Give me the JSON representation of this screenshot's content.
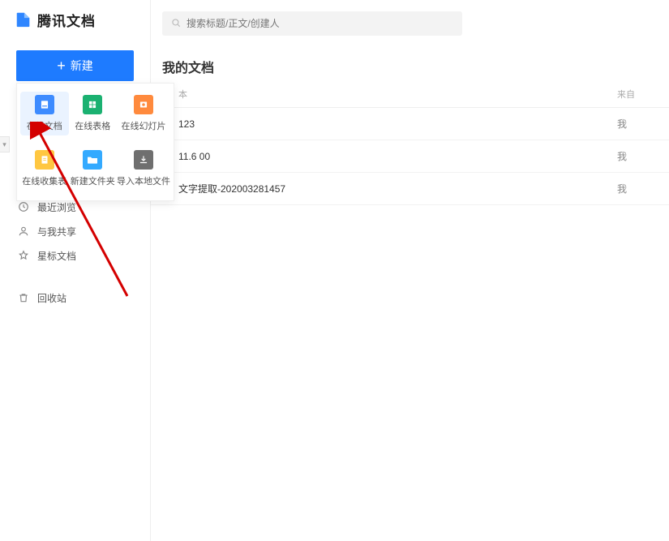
{
  "app": {
    "name": "腾讯文档"
  },
  "sidebar": {
    "new_button": "新建",
    "nav": {
      "recent": "最近浏览",
      "shared": "与我共享",
      "starred": "星标文档",
      "trash": "回收站"
    }
  },
  "new_menu": {
    "items": [
      {
        "label": "在线文档",
        "style": "mi-doc",
        "selected": true
      },
      {
        "label": "在线表格",
        "style": "mi-sheet",
        "selected": false
      },
      {
        "label": "在线幻灯片",
        "style": "mi-slide",
        "selected": false
      },
      {
        "label": "在线收集表",
        "style": "mi-collect",
        "selected": false
      },
      {
        "label": "新建文件夹",
        "style": "mi-folder",
        "selected": false
      },
      {
        "label": "导入本地文件",
        "style": "mi-import",
        "selected": false
      }
    ]
  },
  "search": {
    "placeholder": "搜索标题/正文/创建人"
  },
  "main": {
    "section_title": "我的文档",
    "columns": {
      "name_partial": "本",
      "source": "来自"
    },
    "rows": [
      {
        "name": "123",
        "source": "我"
      },
      {
        "name": "11.6 00",
        "source": "我"
      },
      {
        "name": "文字提取-202003281457",
        "source": "我"
      }
    ]
  },
  "colors": {
    "primary": "#1e7bff",
    "arrow": "#d40000"
  }
}
